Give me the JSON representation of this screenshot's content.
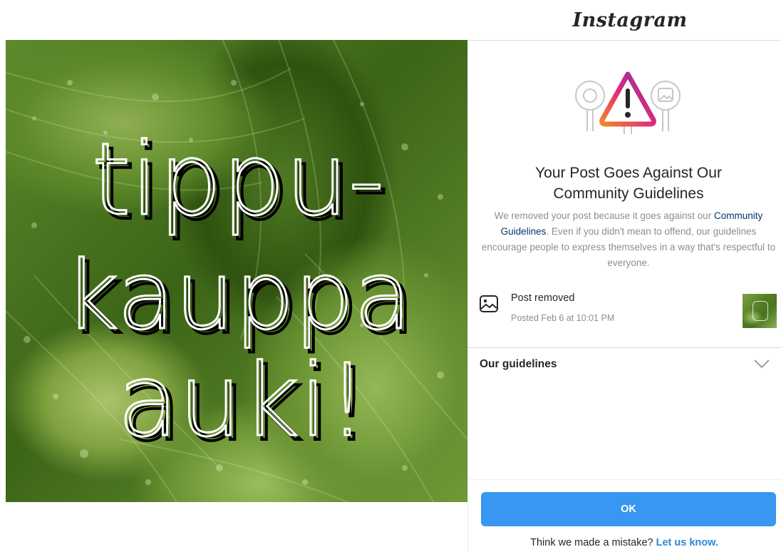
{
  "app": {
    "brand": "Instagram"
  },
  "photo": {
    "overlay_lines": [
      "tippu-",
      "kauppa",
      "auki!"
    ]
  },
  "notice": {
    "title_line1": "Your Post Goes Against Our",
    "title_line2": "Community Guidelines",
    "desc_before": "We removed your post because it goes against our",
    "desc_link": "Community Guidelines",
    "desc_after": ". Even if you didn't mean to offend, our guidelines encourage people to express themselves in a way that's respectful to everyone.",
    "icon": "warning-triangle-icon",
    "accent_gradient": [
      "#f58529",
      "#dd2a7b",
      "#8134af"
    ]
  },
  "post": {
    "icon": "image-icon",
    "label": "Post removed",
    "date": "Posted Feb 6 at 10:01 PM"
  },
  "guidelines": {
    "label": "Our guidelines",
    "icon": "chevron-down-icon"
  },
  "actions": {
    "ok_label": "OK",
    "mistake_text": "Think we made a mistake?",
    "mistake_link": "Let us know."
  },
  "colors": {
    "button_blue": "#3897f0",
    "link_dark": "#00376b",
    "link_blue": "#2b8ad8",
    "muted_text": "#8e8e8e"
  }
}
